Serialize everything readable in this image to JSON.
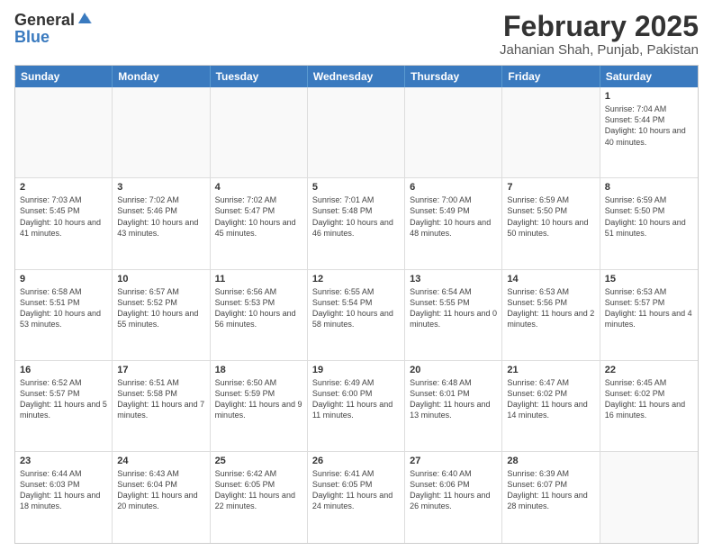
{
  "header": {
    "logo": {
      "general": "General",
      "blue": "Blue"
    },
    "title": "February 2025",
    "location": "Jahanian Shah, Punjab, Pakistan"
  },
  "weekdays": [
    "Sunday",
    "Monday",
    "Tuesday",
    "Wednesday",
    "Thursday",
    "Friday",
    "Saturday"
  ],
  "weeks": [
    [
      {
        "day": "",
        "empty": true
      },
      {
        "day": "",
        "empty": true
      },
      {
        "day": "",
        "empty": true
      },
      {
        "day": "",
        "empty": true
      },
      {
        "day": "",
        "empty": true
      },
      {
        "day": "",
        "empty": true
      },
      {
        "day": "1",
        "sunrise": "Sunrise: 7:04 AM",
        "sunset": "Sunset: 5:44 PM",
        "daylight": "Daylight: 10 hours and 40 minutes."
      }
    ],
    [
      {
        "day": "2",
        "sunrise": "Sunrise: 7:03 AM",
        "sunset": "Sunset: 5:45 PM",
        "daylight": "Daylight: 10 hours and 41 minutes."
      },
      {
        "day": "3",
        "sunrise": "Sunrise: 7:02 AM",
        "sunset": "Sunset: 5:46 PM",
        "daylight": "Daylight: 10 hours and 43 minutes."
      },
      {
        "day": "4",
        "sunrise": "Sunrise: 7:02 AM",
        "sunset": "Sunset: 5:47 PM",
        "daylight": "Daylight: 10 hours and 45 minutes."
      },
      {
        "day": "5",
        "sunrise": "Sunrise: 7:01 AM",
        "sunset": "Sunset: 5:48 PM",
        "daylight": "Daylight: 10 hours and 46 minutes."
      },
      {
        "day": "6",
        "sunrise": "Sunrise: 7:00 AM",
        "sunset": "Sunset: 5:49 PM",
        "daylight": "Daylight: 10 hours and 48 minutes."
      },
      {
        "day": "7",
        "sunrise": "Sunrise: 6:59 AM",
        "sunset": "Sunset: 5:50 PM",
        "daylight": "Daylight: 10 hours and 50 minutes."
      },
      {
        "day": "8",
        "sunrise": "Sunrise: 6:59 AM",
        "sunset": "Sunset: 5:50 PM",
        "daylight": "Daylight: 10 hours and 51 minutes."
      }
    ],
    [
      {
        "day": "9",
        "sunrise": "Sunrise: 6:58 AM",
        "sunset": "Sunset: 5:51 PM",
        "daylight": "Daylight: 10 hours and 53 minutes."
      },
      {
        "day": "10",
        "sunrise": "Sunrise: 6:57 AM",
        "sunset": "Sunset: 5:52 PM",
        "daylight": "Daylight: 10 hours and 55 minutes."
      },
      {
        "day": "11",
        "sunrise": "Sunrise: 6:56 AM",
        "sunset": "Sunset: 5:53 PM",
        "daylight": "Daylight: 10 hours and 56 minutes."
      },
      {
        "day": "12",
        "sunrise": "Sunrise: 6:55 AM",
        "sunset": "Sunset: 5:54 PM",
        "daylight": "Daylight: 10 hours and 58 minutes."
      },
      {
        "day": "13",
        "sunrise": "Sunrise: 6:54 AM",
        "sunset": "Sunset: 5:55 PM",
        "daylight": "Daylight: 11 hours and 0 minutes."
      },
      {
        "day": "14",
        "sunrise": "Sunrise: 6:53 AM",
        "sunset": "Sunset: 5:56 PM",
        "daylight": "Daylight: 11 hours and 2 minutes."
      },
      {
        "day": "15",
        "sunrise": "Sunrise: 6:53 AM",
        "sunset": "Sunset: 5:57 PM",
        "daylight": "Daylight: 11 hours and 4 minutes."
      }
    ],
    [
      {
        "day": "16",
        "sunrise": "Sunrise: 6:52 AM",
        "sunset": "Sunset: 5:57 PM",
        "daylight": "Daylight: 11 hours and 5 minutes."
      },
      {
        "day": "17",
        "sunrise": "Sunrise: 6:51 AM",
        "sunset": "Sunset: 5:58 PM",
        "daylight": "Daylight: 11 hours and 7 minutes."
      },
      {
        "day": "18",
        "sunrise": "Sunrise: 6:50 AM",
        "sunset": "Sunset: 5:59 PM",
        "daylight": "Daylight: 11 hours and 9 minutes."
      },
      {
        "day": "19",
        "sunrise": "Sunrise: 6:49 AM",
        "sunset": "Sunset: 6:00 PM",
        "daylight": "Daylight: 11 hours and 11 minutes."
      },
      {
        "day": "20",
        "sunrise": "Sunrise: 6:48 AM",
        "sunset": "Sunset: 6:01 PM",
        "daylight": "Daylight: 11 hours and 13 minutes."
      },
      {
        "day": "21",
        "sunrise": "Sunrise: 6:47 AM",
        "sunset": "Sunset: 6:02 PM",
        "daylight": "Daylight: 11 hours and 14 minutes."
      },
      {
        "day": "22",
        "sunrise": "Sunrise: 6:45 AM",
        "sunset": "Sunset: 6:02 PM",
        "daylight": "Daylight: 11 hours and 16 minutes."
      }
    ],
    [
      {
        "day": "23",
        "sunrise": "Sunrise: 6:44 AM",
        "sunset": "Sunset: 6:03 PM",
        "daylight": "Daylight: 11 hours and 18 minutes."
      },
      {
        "day": "24",
        "sunrise": "Sunrise: 6:43 AM",
        "sunset": "Sunset: 6:04 PM",
        "daylight": "Daylight: 11 hours and 20 minutes."
      },
      {
        "day": "25",
        "sunrise": "Sunrise: 6:42 AM",
        "sunset": "Sunset: 6:05 PM",
        "daylight": "Daylight: 11 hours and 22 minutes."
      },
      {
        "day": "26",
        "sunrise": "Sunrise: 6:41 AM",
        "sunset": "Sunset: 6:05 PM",
        "daylight": "Daylight: 11 hours and 24 minutes."
      },
      {
        "day": "27",
        "sunrise": "Sunrise: 6:40 AM",
        "sunset": "Sunset: 6:06 PM",
        "daylight": "Daylight: 11 hours and 26 minutes."
      },
      {
        "day": "28",
        "sunrise": "Sunrise: 6:39 AM",
        "sunset": "Sunset: 6:07 PM",
        "daylight": "Daylight: 11 hours and 28 minutes."
      },
      {
        "day": "",
        "empty": true
      }
    ]
  ]
}
